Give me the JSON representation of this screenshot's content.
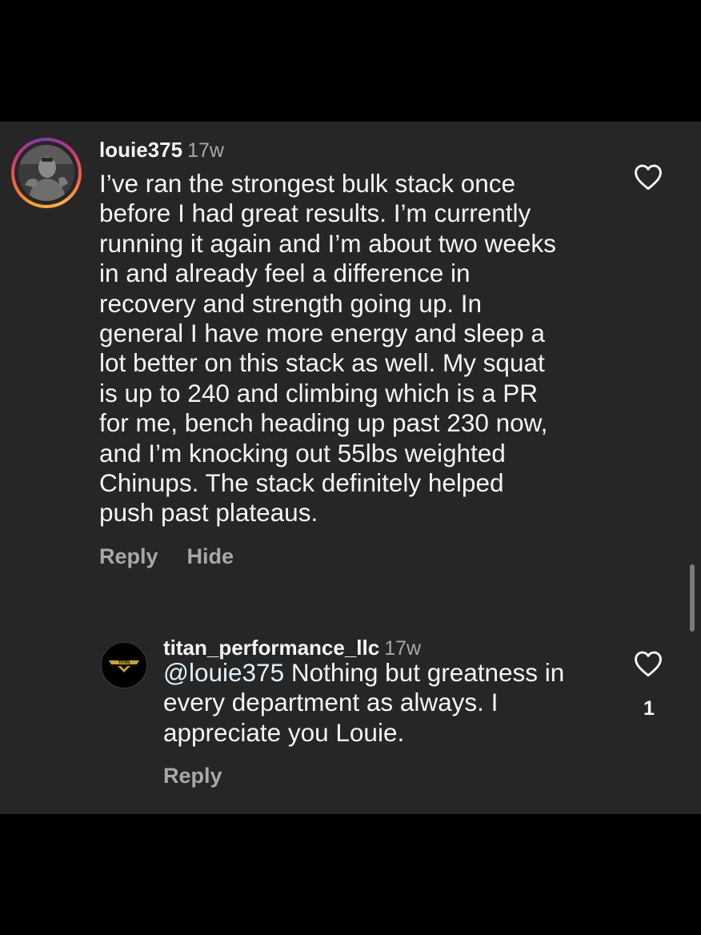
{
  "comments": [
    {
      "username": "louie375",
      "time": "17w",
      "text": [
        "I’ve ran the strongest bulk stack once",
        "before I had great results. I’m currently",
        "running it again and I’m about two weeks",
        "in and already feel a difference in",
        "recovery and strength going up. In",
        "general I have more energy and sleep a",
        "lot better on this stack as well. My squat",
        "is up to 240 and climbing which is a PR",
        "for me, bench heading up past 230 now,",
        "and I’m knocking out 55lbs weighted",
        "Chinups. The stack definitely helped",
        "push past plateaus."
      ],
      "actions": {
        "reply": "Reply",
        "hide": "Hide"
      },
      "like_icon": "heart-outline-icon"
    },
    {
      "username": "titan_performance_llc",
      "time": "17w",
      "mention": "@louie375",
      "text": [
        " Nothing but greatness in",
        "every department as always. I",
        "appreciate you Louie."
      ],
      "actions": {
        "reply": "Reply"
      },
      "like_icon": "heart-outline-icon",
      "like_count": "1",
      "avatar_label": "TITAN"
    }
  ],
  "colors": {
    "panel": "#262626",
    "text": "#f5f5f5",
    "muted": "#a8a8a8",
    "mention": "#e0f1ff"
  }
}
